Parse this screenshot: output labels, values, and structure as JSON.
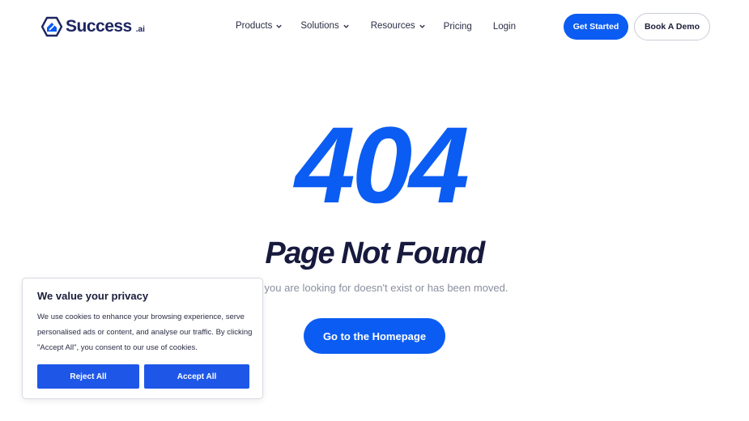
{
  "header": {
    "logo": {
      "text": "Success",
      "suffix": ".ai",
      "icon": "house-badge-icon"
    },
    "nav": {
      "products": "Products",
      "solutions": "Solutions",
      "resources": "Resources",
      "pricing": "Pricing",
      "login": "Login"
    },
    "get_started": "Get Started",
    "book_demo": "Book A Demo"
  },
  "hero": {
    "code": "404",
    "title": "Page Not Found",
    "subtitle": "ge you are looking for doesn't exist or has been moved.",
    "home_button": "Go to the Homepage"
  },
  "cookie_banner": {
    "title": "We value your privacy",
    "text": "We use cookies to enhance your browsing experience, serve personalised ads or content, and analyse our traffic. By clicking \"Accept All\", you consent to our use of cookies.",
    "reject": "Reject All",
    "accept": "Accept All"
  },
  "colors": {
    "primary": "#0b5cf2",
    "heading": "#171a3d",
    "muted": "#8b8f9e",
    "cookie_button": "#1e57e8"
  }
}
